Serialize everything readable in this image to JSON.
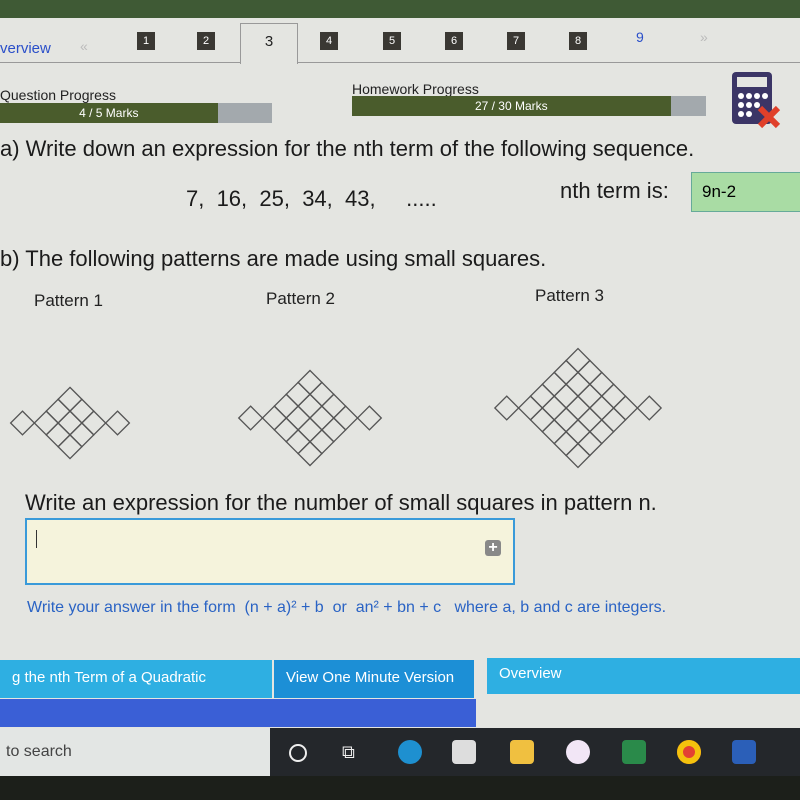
{
  "tabs": {
    "overview": "verview",
    "prev": "«",
    "items": [
      "1",
      "2",
      "3",
      "4",
      "5",
      "6",
      "7",
      "8",
      "9"
    ],
    "active": "3",
    "next": "»"
  },
  "progress": {
    "question_label": "Question Progress",
    "question_text": "4 / 5 Marks",
    "question_fraction": 0.8,
    "homework_label": "Homework Progress",
    "homework_text": "27 / 30 Marks",
    "homework_fraction": 0.9
  },
  "calculator_icon": "calculator-icon",
  "part_a": {
    "prompt": "a) Write down an expression for the nth term of the following sequence.",
    "sequence": "7,  16,  25,  34,  43,     .....",
    "answer_label": "nth term is:",
    "answer_value": "9n-2"
  },
  "part_b": {
    "prompt": "b) The following patterns are made using small squares.",
    "patterns": [
      "Pattern 1",
      "Pattern 2",
      "Pattern 3"
    ],
    "question": "Write an expression for the number of small squares in pattern n.",
    "input_value": "",
    "hint": "Write your answer in the form  (n + a)² + b  or  an² + bn + c   where a, b and c are integers."
  },
  "buttons": {
    "lesson": "g the nth Term of a Quadratic",
    "one_minute": "View One Minute Version",
    "overview": "Overview"
  },
  "taskbar": {
    "search": "to search",
    "icons": [
      "cortana-icon",
      "task-view-icon",
      "edge-icon",
      "store-icon",
      "file-explorer-icon",
      "itunes-icon",
      "excel-icon",
      "chrome-icon",
      "word-icon"
    ]
  }
}
